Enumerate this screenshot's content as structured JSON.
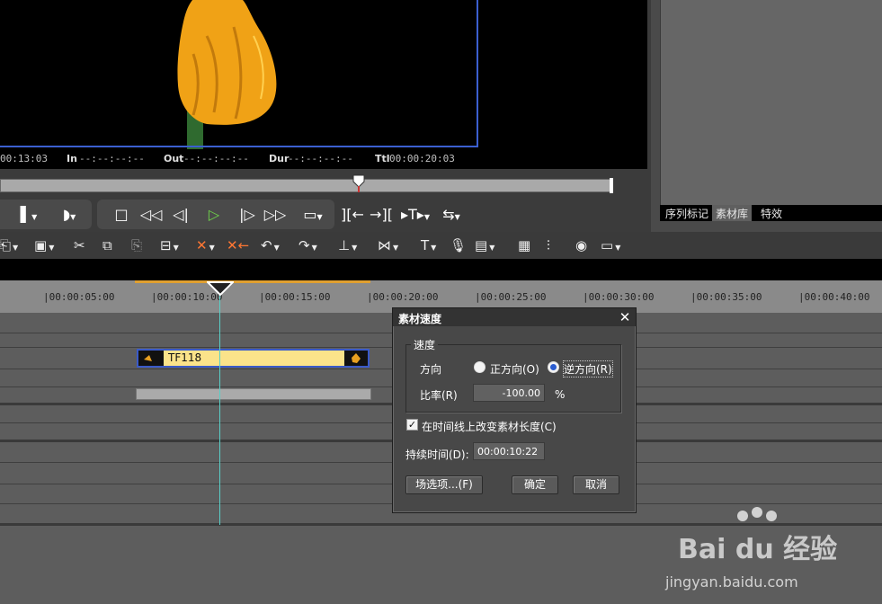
{
  "player": {
    "timecode_current": "00:13:03",
    "in_label": "In",
    "in_value": "--:--:--:--",
    "out_label": "Out",
    "out_value": "--:--:--:--",
    "dur_label": "Dur",
    "dur_value": "--:--:--:--",
    "ttl_label": "Ttl",
    "ttl_value": "00:00:20:03",
    "scrub_position": 0.58
  },
  "right_panel": {
    "tabs": [
      {
        "label": "序列标记"
      },
      {
        "label": "素材库",
        "active": true
      },
      {
        "label": "特效"
      }
    ]
  },
  "timeline": {
    "ruler_ticks": [
      "|00:00:05:00",
      "|00:00:10:00",
      "|00:00:15:00",
      "|00:00:20:00",
      "|00:00:25:00",
      "|00:00:30:00",
      "|00:00:35:00",
      "|00:00:40:00"
    ],
    "clip_name": "TF118"
  },
  "dialog": {
    "title": "素材速度",
    "close": "✕",
    "group_title": "速度",
    "direction_label": "方向",
    "forward_label": "正方向(O)",
    "reverse_label": "逆方向(R)",
    "direction_selected": "reverse",
    "rate_label": "比率(R)",
    "rate_value": "-100.00",
    "rate_unit": "%",
    "change_length_label": "在时间线上改变素材长度(C)",
    "change_length_checked": true,
    "duration_label": "持续时间(D):",
    "duration_value": "00:00:10:22",
    "field_options_button": "场选项...(F)",
    "ok_button": "确定",
    "cancel_button": "取消"
  },
  "watermark": {
    "brand": "Bai du 经验",
    "url": "jingyan.baidu.com"
  },
  "colors": {
    "selection_blue": "#3a5ac8",
    "playhead_cyan": "#5ad0c8",
    "clip_yellow": "#fbe38a",
    "in_out_orange": "#e0a030"
  }
}
